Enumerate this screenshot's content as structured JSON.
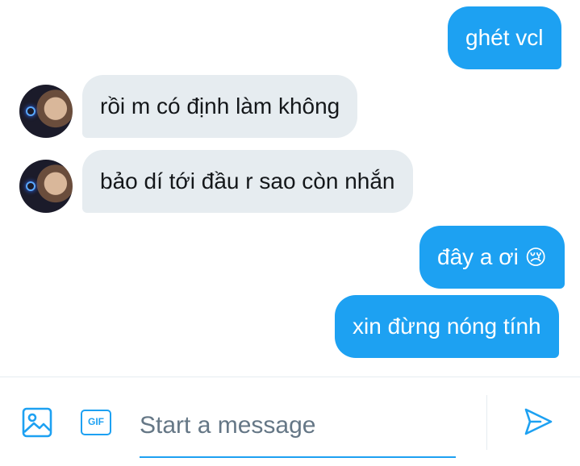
{
  "messages": [
    {
      "direction": "outgoing",
      "text": "ghét vcl"
    },
    {
      "direction": "incoming",
      "text": "rồi m có định làm không"
    },
    {
      "direction": "incoming",
      "text": "bảo dí tới đầu r sao còn nhắn"
    },
    {
      "direction": "outgoing",
      "text": "đây a ơi",
      "emoji": "😢"
    },
    {
      "direction": "outgoing",
      "text": "xin đừng nóng tính"
    }
  ],
  "composer": {
    "placeholder": "Start a message",
    "gif_label": "GIF",
    "image_icon": "image-icon",
    "send_icon": "send-icon"
  },
  "colors": {
    "outgoing_bubble": "#1da1f2",
    "incoming_bubble": "#e6ecf0",
    "accent": "#1da1f2",
    "placeholder": "#657786"
  }
}
